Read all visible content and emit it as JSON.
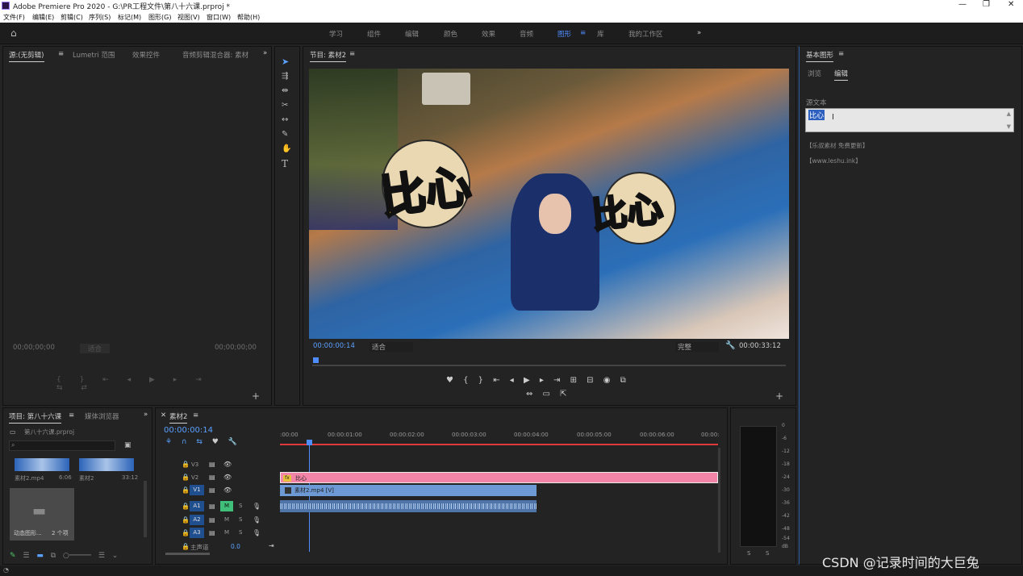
{
  "app": {
    "title": "Adobe Premiere Pro 2020 - G:\\PR工程文件\\第八十六课.prproj *",
    "menu": [
      "文件(F)",
      "编辑(E)",
      "剪辑(C)",
      "序列(S)",
      "标记(M)",
      "图形(G)",
      "视图(V)",
      "窗口(W)",
      "帮助(H)"
    ]
  },
  "workspaces": [
    "学习",
    "组件",
    "编辑",
    "颜色",
    "效果",
    "音频",
    "图形",
    "库",
    "我的工作区"
  ],
  "workspace_more": "»",
  "source_panel": {
    "tabs": [
      "源:(无剪辑)",
      "Lumetri 范围",
      "效果控件",
      "音频剪辑混合器: 素材"
    ],
    "timecode_left": "00;00;00;00",
    "timecode_right": "00;00;00;00",
    "fit": "适合"
  },
  "program_panel": {
    "tab": "节目: 素材2",
    "timecode": "00:00:00:14",
    "fit": "适合",
    "quality": "完整",
    "duration": "00:00:33:12",
    "overlay_text_1": "比心",
    "overlay_text_2": "比心"
  },
  "essential_graphics": {
    "tab": "基本图形",
    "subtabs": [
      "浏览",
      "编辑"
    ],
    "section_label": "源文本",
    "text_value": "比心",
    "watermark_1": "【乐叔素材 免费更新】",
    "watermark_2": "【www.leshu.ink】"
  },
  "project_panel": {
    "tabs": [
      "项目: 第八十六课",
      "媒体浏览器"
    ],
    "project_file": "第八十六课.prproj",
    "items": [
      {
        "name": "素材2.mp4",
        "duration": "6:06"
      },
      {
        "name": "素材2",
        "duration": "33:12"
      },
      {
        "name": "动态图形...",
        "duration": "2 个项"
      }
    ]
  },
  "timeline": {
    "tab": "素材2",
    "timecode": "00:00:00:14",
    "ruler": [
      ":00:00",
      "00:00:01:00",
      "00:00:02:00",
      "00:00:03:00",
      "00:00:04:00",
      "00:00:05:00",
      "00:00:06:00",
      "00:00:"
    ],
    "tracks": [
      {
        "id": "V3",
        "type": "video"
      },
      {
        "id": "V2",
        "type": "video"
      },
      {
        "id": "V1",
        "type": "video"
      },
      {
        "id": "A1",
        "type": "audio"
      },
      {
        "id": "A2",
        "type": "audio"
      },
      {
        "id": "A3",
        "type": "audio"
      }
    ],
    "master_label": "主声道",
    "master_value": "0.0",
    "clip_v2": "比心",
    "clip_v1": "素材2.mp4 [V]"
  },
  "meter": {
    "scale": [
      "0",
      "-6",
      "-12",
      "-18",
      "-24",
      "-30",
      "-36",
      "-42",
      "-48",
      "-54",
      "dB"
    ],
    "solo": [
      "S",
      "S"
    ]
  },
  "watermark": "CSDN @记录时间的大巨兔",
  "colors": {
    "accent_blue": "#4f8dff",
    "clip_pink": "#f284a8",
    "clip_blue": "#6d99d4",
    "playhead_red": "#e03a3a"
  }
}
